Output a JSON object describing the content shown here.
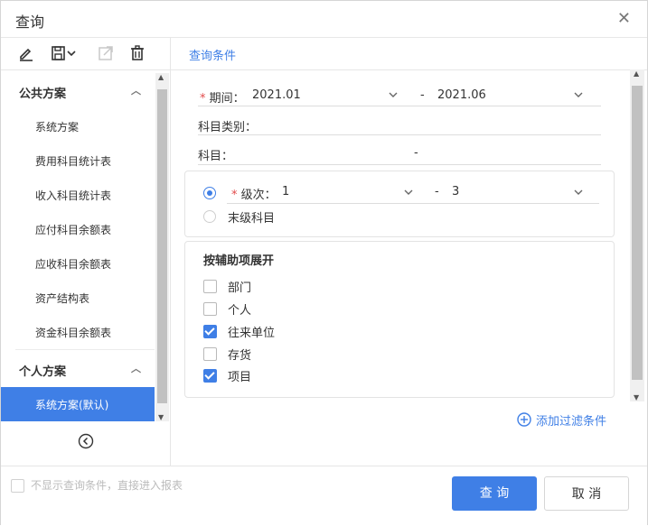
{
  "dialog": {
    "title": "查询"
  },
  "left": {
    "toolbar": [
      "edit-icon",
      "save-icon",
      "export-icon",
      "delete-icon"
    ],
    "public_group": {
      "label": "公共方案",
      "items": [
        {
          "label": "系统方案"
        },
        {
          "label": "费用科目统计表"
        },
        {
          "label": "收入科目统计表"
        },
        {
          "label": "应付科目余额表"
        },
        {
          "label": "应收科目余额表"
        },
        {
          "label": "资产结构表"
        },
        {
          "label": "资金科目余额表"
        }
      ]
    },
    "personal_group": {
      "label": "个人方案",
      "items": [
        {
          "label": "系统方案(默认)"
        }
      ]
    }
  },
  "right": {
    "tab": "查询条件",
    "period": {
      "label": "期间：",
      "from": "2021.01",
      "dash": "-",
      "to": "2021.06"
    },
    "category": {
      "label": "科目类别："
    },
    "subject": {
      "label": "科目：",
      "dash": "-"
    },
    "level": {
      "label": "级次：",
      "from": "1",
      "dash": "-",
      "to": "3"
    },
    "leaf": {
      "label": "末级科目"
    },
    "aux": {
      "title": "按辅助项展开",
      "options": [
        {
          "label": "部门",
          "checked": false
        },
        {
          "label": "个人",
          "checked": false
        },
        {
          "label": "往来单位",
          "checked": true
        },
        {
          "label": "存货",
          "checked": false
        },
        {
          "label": "项目",
          "checked": true
        }
      ]
    },
    "add_filter": "添加过滤条件"
  },
  "footer": {
    "skip_label": "不显示查询条件，直接进入报表",
    "query_button": "查 询",
    "cancel_button": "取 消"
  },
  "colors": {
    "accent": "#3f7fe6",
    "required": "#e24b4b"
  }
}
